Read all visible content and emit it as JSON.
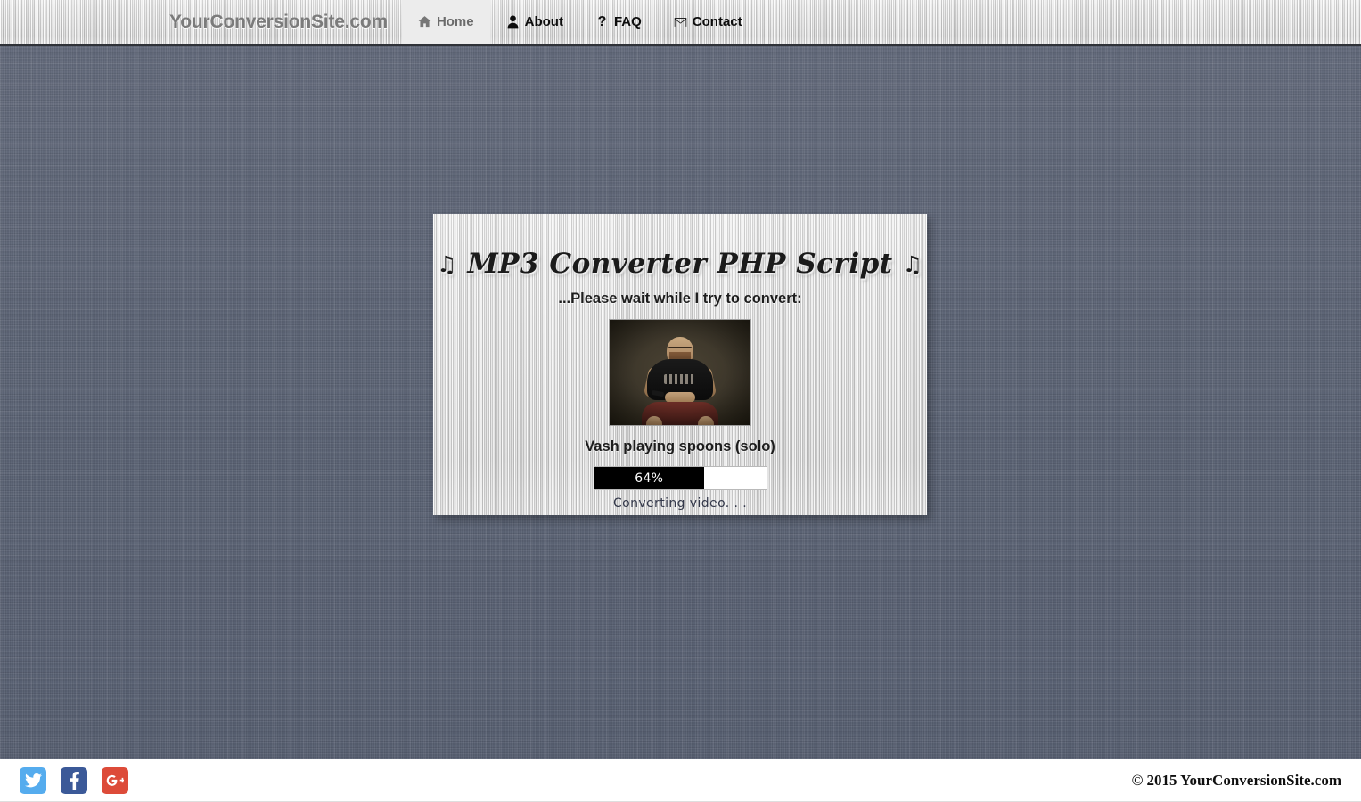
{
  "navbar": {
    "brand": "YourConversionSite.com",
    "items": [
      {
        "label": "Home",
        "icon": "home-icon",
        "active": true
      },
      {
        "label": "About",
        "icon": "user-icon",
        "active": false
      },
      {
        "label": "FAQ",
        "icon": "question-icon",
        "active": false
      },
      {
        "label": "Contact",
        "icon": "envelope-icon",
        "active": false
      }
    ]
  },
  "card": {
    "title": "MP3 Converter PHP Script",
    "title_note_left": "♫",
    "title_note_right": "♫",
    "subtitle": "...Please wait while I try to convert:",
    "video_title": "Vash playing spoons (solo)",
    "thumbnail_alt": "video-thumbnail",
    "progress": {
      "percent": 64,
      "label": "64%",
      "status": "Converting video. . ."
    }
  },
  "footer": {
    "social": [
      {
        "name": "twitter",
        "color": "#55acee",
        "label": "Twitter"
      },
      {
        "name": "facebook",
        "color": "#3b5998",
        "label": "Facebook"
      },
      {
        "name": "google-plus",
        "color": "#dd4b39",
        "label": "Google Plus"
      }
    ],
    "copyright": "© 2015 YourConversionSite.com"
  },
  "colors": {
    "page_bg": "#5d6475",
    "metal": "#d2d2d2",
    "nav_active_bg": "#ececec",
    "brand_text": "#7b7b7b",
    "progress_fill": "#000000",
    "progress_track": "#ffffff",
    "footer_bg": "#ffffff"
  }
}
